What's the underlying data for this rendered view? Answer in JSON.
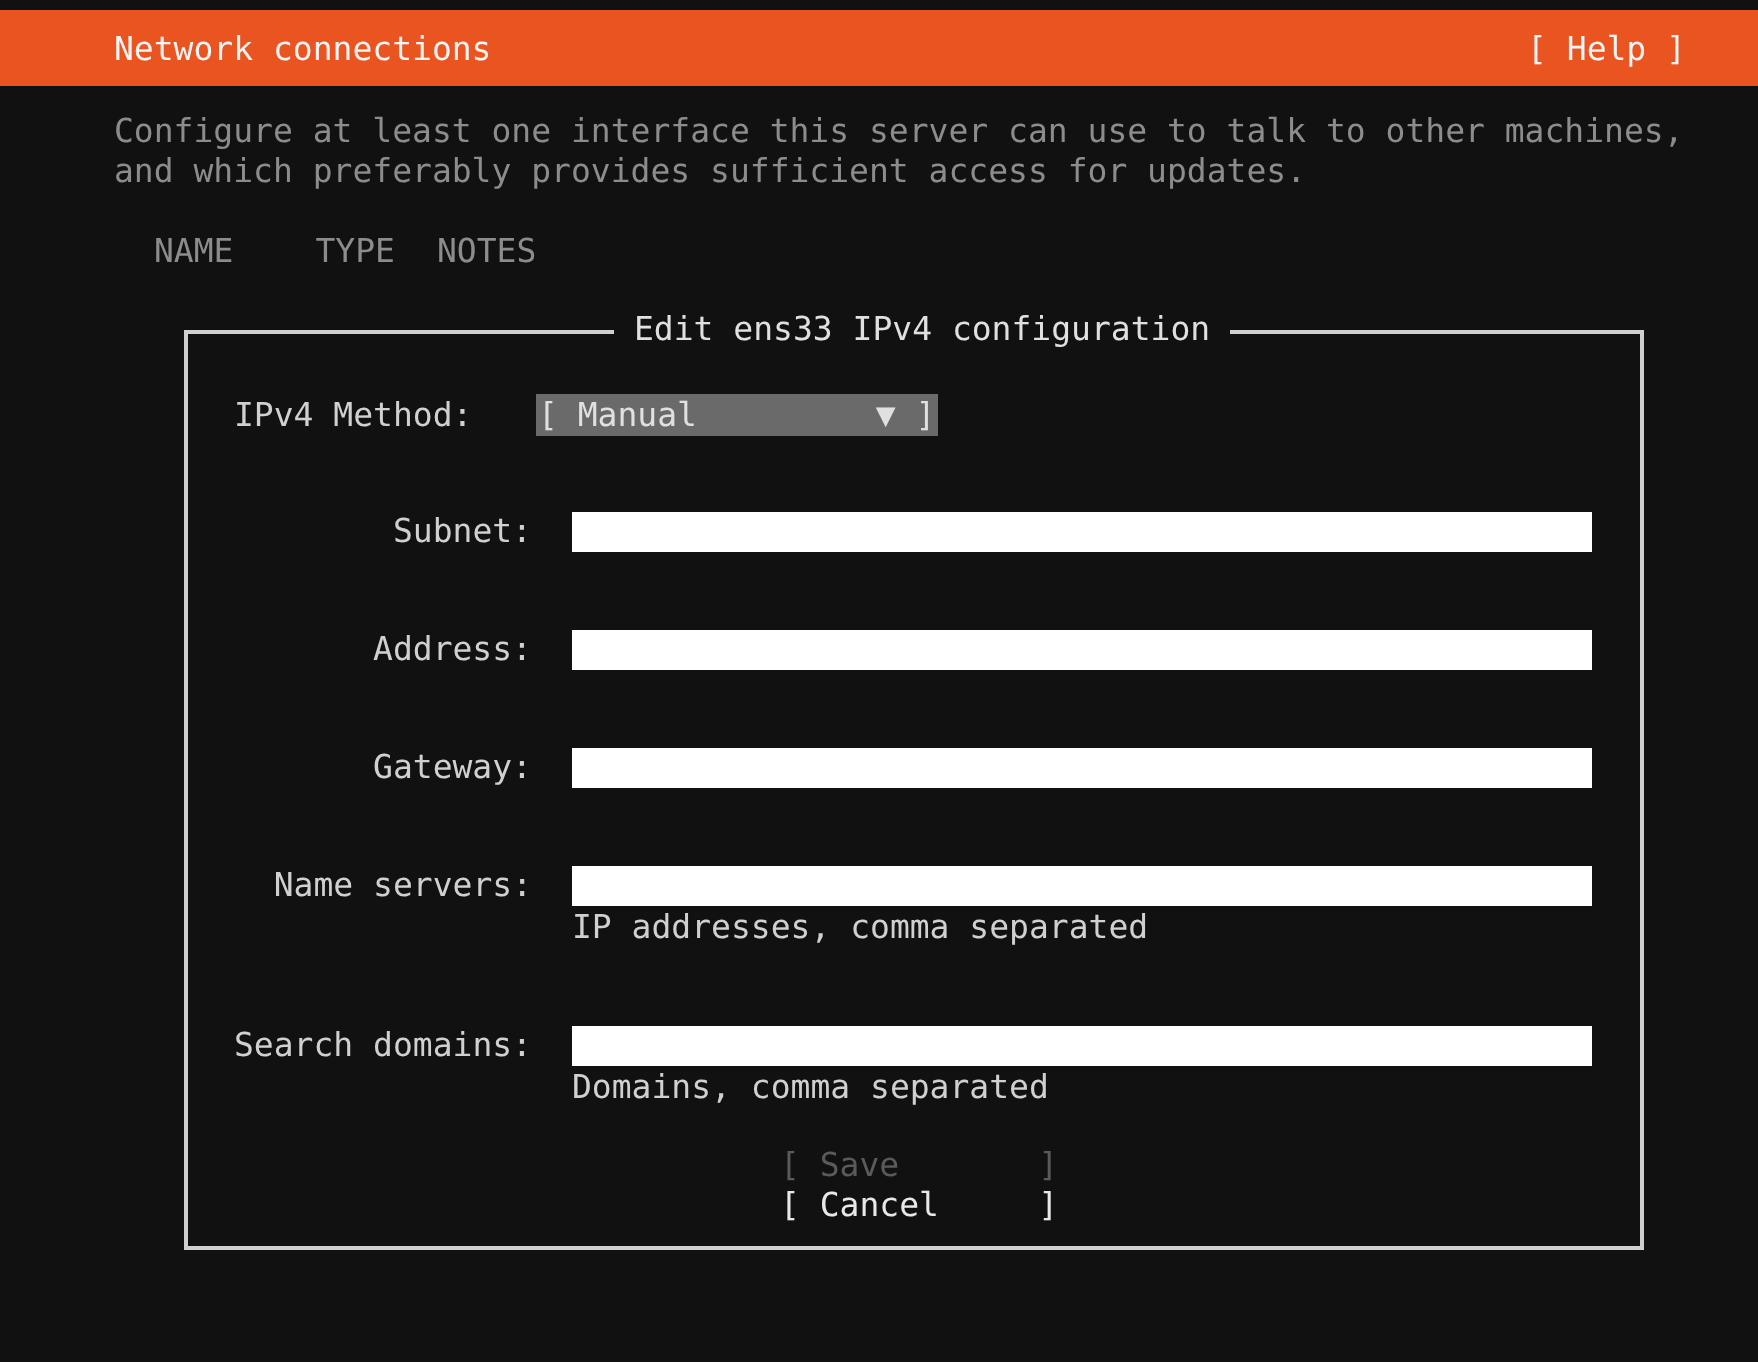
{
  "header": {
    "title": "Network connections",
    "help": "[ Help ]"
  },
  "description": [
    "Configure at least one interface this server can use to talk to other machines,",
    "and which preferably provides sufficient access for updates."
  ],
  "columns": [
    "NAME",
    "TYPE",
    "NOTES"
  ],
  "dialog": {
    "title": "Edit ens33 IPv4 configuration",
    "method": {
      "label": "IPv4 Method:",
      "value": "[ Manual         ▼ ]",
      "focused": true
    },
    "fields": [
      {
        "label": "Subnet:"
      },
      {
        "label": "Address:"
      },
      {
        "label": "Gateway:"
      },
      {
        "label": "Name servers:",
        "hint": "IP addresses, comma separated"
      },
      {
        "label": "Search domains:",
        "hint": "Domains, comma separated"
      }
    ],
    "buttons": [
      {
        "label": "[ Save       ]",
        "disabled": true
      },
      {
        "label": "[ Cancel     ]",
        "disabled": false
      }
    ]
  }
}
